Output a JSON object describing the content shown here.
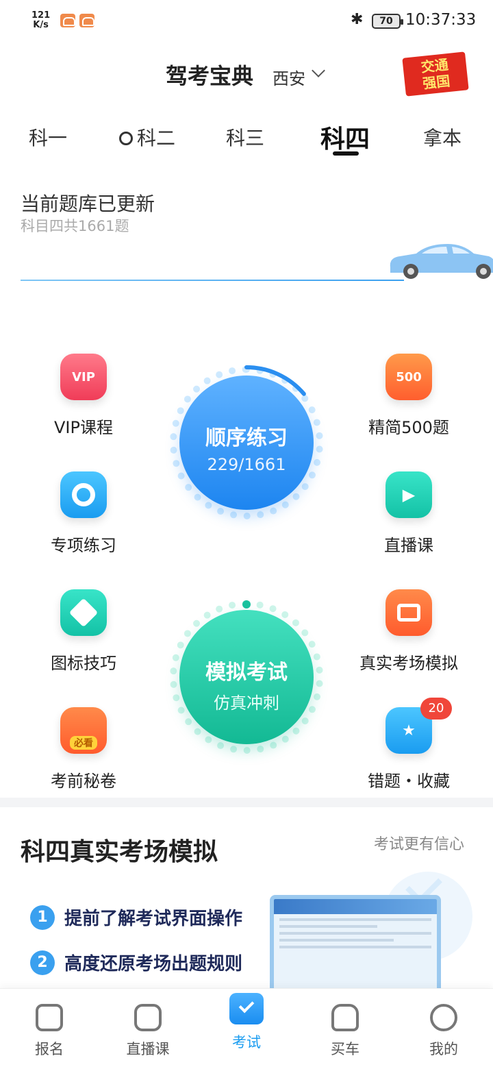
{
  "status_bar": {
    "net_speed_value": "121",
    "net_speed_unit": "K/s",
    "battery": "70",
    "time": "10:37:33"
  },
  "header": {
    "app_title": "驾考宝典",
    "city": "西安",
    "slogan_line1": "交通",
    "slogan_line2": "强国"
  },
  "tabs": [
    {
      "label": "科一"
    },
    {
      "label": "科二"
    },
    {
      "label": "科三"
    },
    {
      "label": "科四",
      "active": true
    },
    {
      "label": "拿本"
    }
  ],
  "update_panel": {
    "title": "当前题库已更新",
    "subtitle": "科目四共1661题"
  },
  "functions": {
    "vip": "VIP课程",
    "vip_icon_text": "VIP",
    "jing500": "精简500题",
    "jing500_icon_text": "500",
    "special": "专项练习",
    "live": "直播课",
    "signs": "图标技巧",
    "real_exam": "真实考场模拟",
    "secret": "考前秘卷",
    "secret_icon_text": "必看",
    "wrong_fav": "错题・收藏",
    "wrong_fav_badge": "20"
  },
  "practice": {
    "title": "顺序练习",
    "progress_text": "229/1661",
    "progress_fraction": 0.138
  },
  "mock_exam": {
    "title": "模拟考试",
    "subtitle": "仿真冲刺"
  },
  "simulation": {
    "title": "科四真实考场模拟",
    "tag": "考试更有信心",
    "points": [
      {
        "num": "1",
        "text": "提前了解考试界面操作"
      },
      {
        "num": "2",
        "text": "高度还原考场出题规则"
      }
    ]
  },
  "bottom_nav": [
    {
      "label": "报名"
    },
    {
      "label": "直播课"
    },
    {
      "label": "考试",
      "active": true
    },
    {
      "label": "买车"
    },
    {
      "label": "我的"
    }
  ],
  "colors": {
    "accent_blue": "#1a9cf0",
    "accent_green": "#13b994",
    "badge_red": "#f0463a"
  }
}
